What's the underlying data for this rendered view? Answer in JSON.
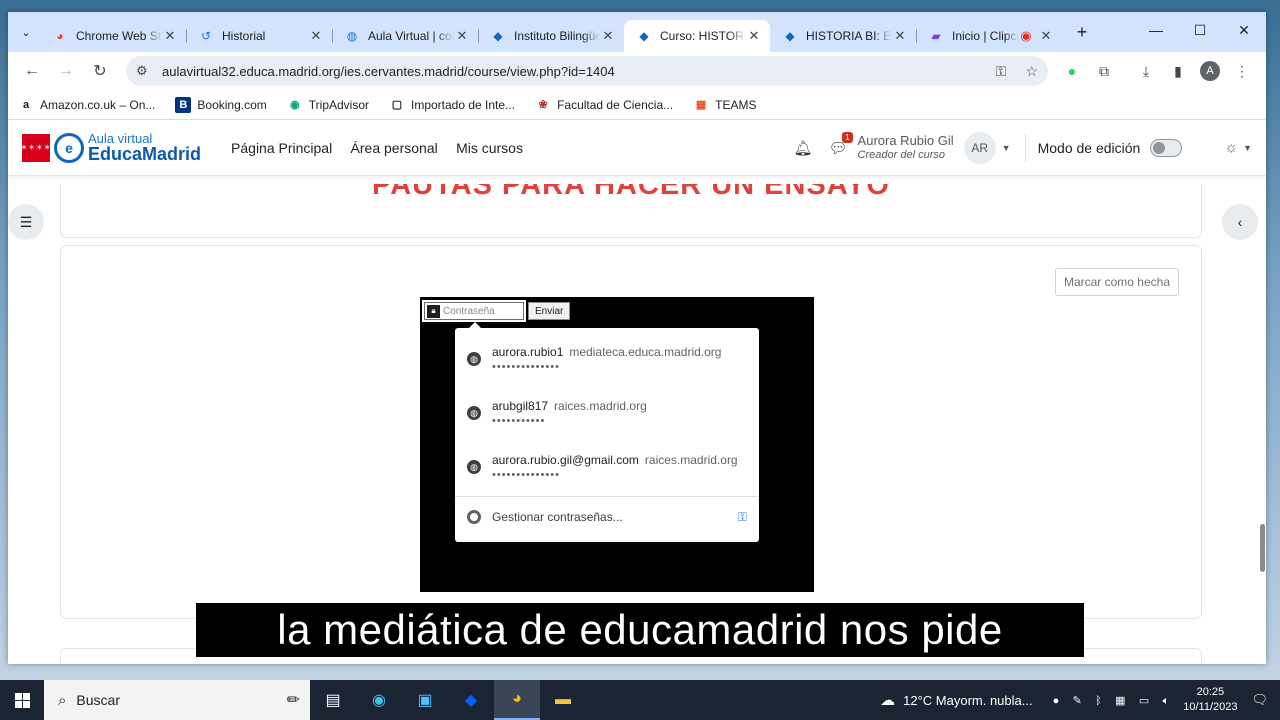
{
  "browser": {
    "tabs": [
      {
        "title": "Chrome Web Store",
        "icon": "chrome-icon"
      },
      {
        "title": "Historial",
        "icon": "history-icon"
      },
      {
        "title": "Aula Virtual | colegio",
        "icon": "globe-icon"
      },
      {
        "title": "Instituto Bilingüe",
        "icon": "graduation-cap-icon"
      },
      {
        "title": "Curso: HISTORIA",
        "icon": "graduation-cap-icon"
      },
      {
        "title": "HISTORIA BI: Ensayo",
        "icon": "graduation-cap-icon"
      },
      {
        "title": "Inicio | Clipchamp",
        "icon": "clipchamp-icon"
      }
    ],
    "url": "aulavirtual32.educa.madrid.org/ies.cervantes.madrid/course/view.php?id=1404",
    "bookmarks": [
      {
        "label": "Amazon.co.uk – On...",
        "icon": "a"
      },
      {
        "label": "Booking.com",
        "icon": "B"
      },
      {
        "label": "TripAdvisor",
        "icon": "◉"
      },
      {
        "label": "Importado de Inte...",
        "icon": "▢"
      },
      {
        "label": "Facultad de Ciencia...",
        "icon": "❀"
      },
      {
        "label": "TEAMS",
        "icon": "▦"
      }
    ],
    "profile_initial": "A"
  },
  "moodle": {
    "logo_top": "Aula virtual",
    "logo_bottom": "EducaMadrid",
    "logo_flag": "✶✶✶✶",
    "nav": [
      "Página Principal",
      "Área personal",
      "Mis cursos"
    ],
    "user_name": "Aurora Rubio Gil",
    "user_role": "Creador del curso",
    "avatar_initials": "AR",
    "message_count": "1",
    "edit_mode_label": "Modo de edición",
    "edit_mode_on": false,
    "heading": "PAUTAS PARA HACER UN ENSAYO",
    "mark_done_label": "Marcar como hecha"
  },
  "embed": {
    "password_placeholder": "Contraseña",
    "send_label": "Enviar",
    "saved_passwords": [
      {
        "user": "aurora.rubio1",
        "domain": "mediateca.educa.madrid.org",
        "mask": "••••••••••••••"
      },
      {
        "user": "arubgil817",
        "domain": "raices.madrid.org",
        "mask": "•••••••••••"
      },
      {
        "user": "aurora.rubio.gil@gmail.com",
        "domain": "raices.madrid.org",
        "mask": "••••••••••••••"
      }
    ],
    "manage_label": "Gestionar contraseñas..."
  },
  "caption": "la mediática de educamadrid nos pide",
  "taskbar": {
    "search_label": "Buscar",
    "weather": "12°C  Mayorm. nubla...",
    "time": "20:25",
    "date": "10/11/2023"
  }
}
